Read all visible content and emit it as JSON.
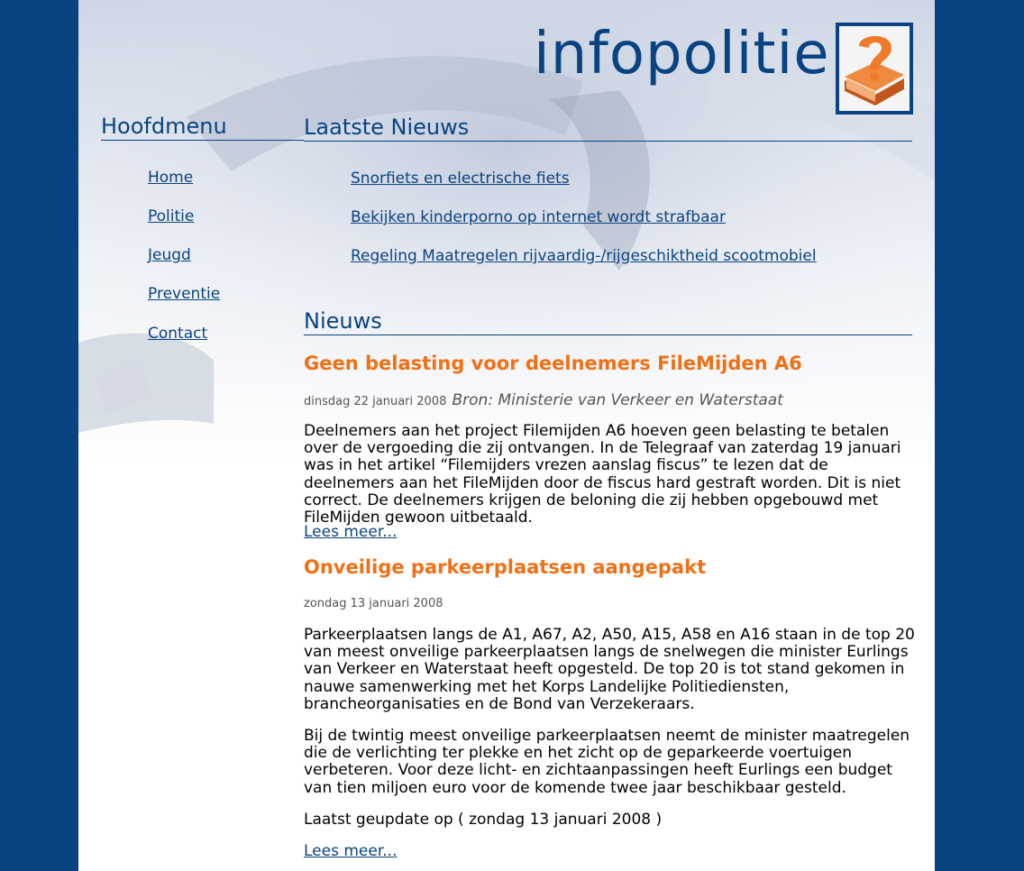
{
  "site": {
    "logo_text": "infopolitie"
  },
  "menu": {
    "title": "Hoofdmenu",
    "items": [
      "Home",
      "Politie",
      "Jeugd",
      "Preventie",
      "Contact"
    ]
  },
  "latest": {
    "title": "Laatste Nieuws",
    "items": [
      "Snorfiets en electrische fiets",
      "Bekijken kinderporno op internet wordt strafbaar",
      "Regeling Maatregelen rijvaardig-/rijgeschiktheid scootmobiel"
    ]
  },
  "news": {
    "title": "Nieuws",
    "articles": [
      {
        "title": "Geen belasting voor deelnemers FileMijden A6",
        "date": "dinsdag 22 januari 2008",
        "source": "Bron: Ministerie van Verkeer en Waterstaat",
        "paragraphs": [
          "Deelnemers aan het project Filemijden A6 hoeven geen belasting te betalen over de vergoeding die zij ontvangen. In de Telegraaf van zaterdag 19 januari was in het artikel “Filemijders vrezen aanslag fiscus” te lezen dat de deelnemers aan het FileMijden door de fiscus hard gestraft worden. Dit is niet correct. De deelnemers krijgen de beloning die zij hebben opgebouwd met FileMijden gewoon uitbetaald."
        ],
        "more": "Lees meer..."
      },
      {
        "title": "Onveilige parkeerplaatsen aangepakt",
        "date": "zondag 13 januari 2008",
        "paragraphs": [
          "Parkeerplaatsen langs de A1, A67, A2, A50, A15, A58 en A16 staan in de top 20 van meest onveilige parkeerplaatsen langs de snelwegen die minister Eurlings van Verkeer en Waterstaat heeft opgesteld. De top 20 is tot stand gekomen in nauwe samenwerking met het Korps Landelijke Politiediensten, brancheorganisaties en de Bond van Verzekeraars.",
          "Bij de twintig meest onveilige parkeerplaatsen neemt de minister maatregelen die de verlichting ter plekke en het zicht op de geparkeerde voertuigen verbeteren. Voor deze licht- en zichtaanpassingen heeft Eurlings een budget van tien miljoen euro voor de komende twee jaar beschikbaar gesteld.",
          "Laatst geupdate op ( zondag 13 januari 2008 )"
        ],
        "more": "Lees meer..."
      }
    ]
  },
  "colors": {
    "brand_blue": "#0a4381",
    "accent_orange": "#f07016"
  }
}
